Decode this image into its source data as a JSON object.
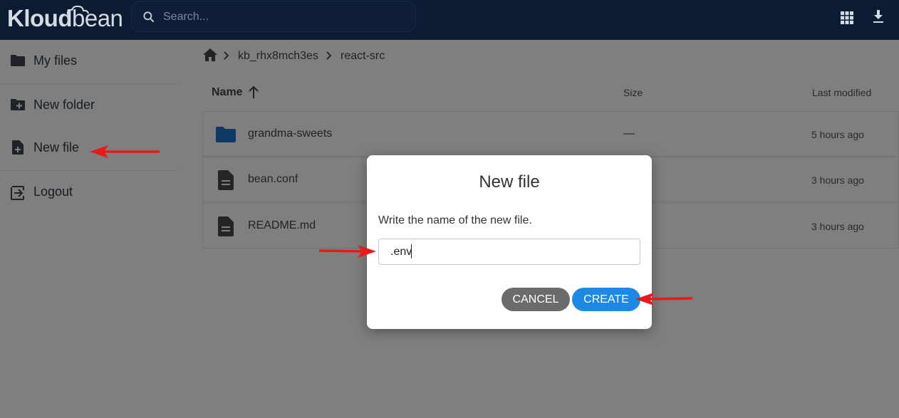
{
  "header": {
    "logo_part1": "Kloud",
    "logo_part2": "bean",
    "search_placeholder": "Search...",
    "icons": [
      "grid-view-icon",
      "download-icon"
    ]
  },
  "sidebar": {
    "items": [
      {
        "label": "My files",
        "icon": "folder-icon"
      },
      {
        "label": "New folder",
        "icon": "create-folder-icon"
      },
      {
        "label": "New file",
        "icon": "new-file-icon"
      },
      {
        "label": "Logout",
        "icon": "logout-icon"
      }
    ]
  },
  "breadcrumb": {
    "home_icon": "home-icon",
    "items": [
      "kb_rhx8mch3es",
      "react-src"
    ]
  },
  "listing": {
    "columns": {
      "name": "Name",
      "size": "Size",
      "modified": "Last modified"
    },
    "sort_icon": "arrow-up-icon",
    "rows": [
      {
        "name": "grandma-sweets",
        "size": "—",
        "modified": "5 hours ago",
        "icon": "folder-icon"
      },
      {
        "name": "bean.conf",
        "size": "",
        "modified": "3 hours ago",
        "icon": "file-icon"
      },
      {
        "name": "README.md",
        "size": "",
        "modified": "3 hours ago",
        "icon": "file-icon"
      }
    ]
  },
  "dialog": {
    "title": "New file",
    "prompt": "Write the name of the new file.",
    "input_value": ".env",
    "cancel_label": "CANCEL",
    "create_label": "CREATE"
  },
  "colors": {
    "header_bg": "#0c1a32",
    "accent": "#1e88e5",
    "cancel": "#6b6b6b",
    "annotation_arrow": "#e8191b"
  }
}
